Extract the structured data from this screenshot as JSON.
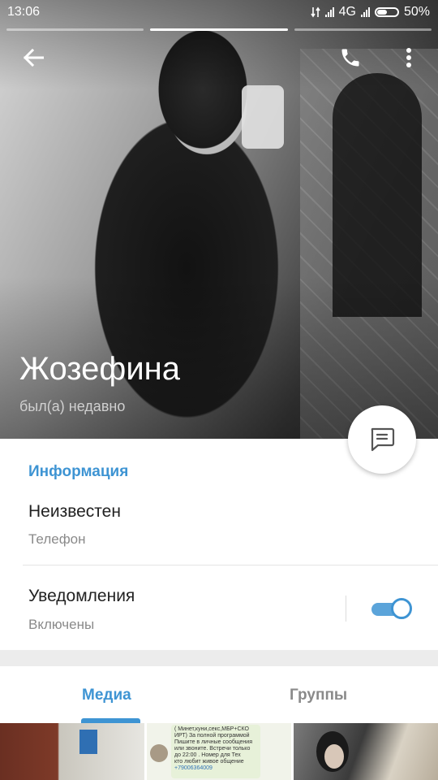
{
  "status_bar": {
    "time": "13:06",
    "network": "4G",
    "battery": "50%",
    "battery_level": 0.5
  },
  "story_progress": {
    "segments": 3,
    "active_index": 1
  },
  "toolbar": {
    "back_icon": "arrow-left-icon",
    "call_icon": "phone-icon",
    "menu_icon": "more-vert-icon"
  },
  "profile": {
    "name": "Жозефина",
    "status": "был(а) недавно"
  },
  "info": {
    "section_title": "Информация",
    "phone_value": "Неизвестен",
    "phone_label": "Телефон",
    "notifications_label": "Уведомления",
    "notifications_value": "Включены",
    "notifications_enabled": true
  },
  "tabs": [
    {
      "label": "Медиа",
      "active": true
    },
    {
      "label": "Группы",
      "active": false
    }
  ],
  "media_thumbs": {
    "t2_lines": [
      "( Минет,куни,секс,МБР+СКО",
      "ИРТ) За полной программой",
      "Пишите в личные сообщения",
      "или звоните. Встречи только",
      "до 22:00 . Номер для Тех",
      "кто любит живое общение"
    ],
    "t2_phone": "+79006364009"
  },
  "colors": {
    "accent": "#3e94d3",
    "secondary_text": "#8a8a8a"
  }
}
